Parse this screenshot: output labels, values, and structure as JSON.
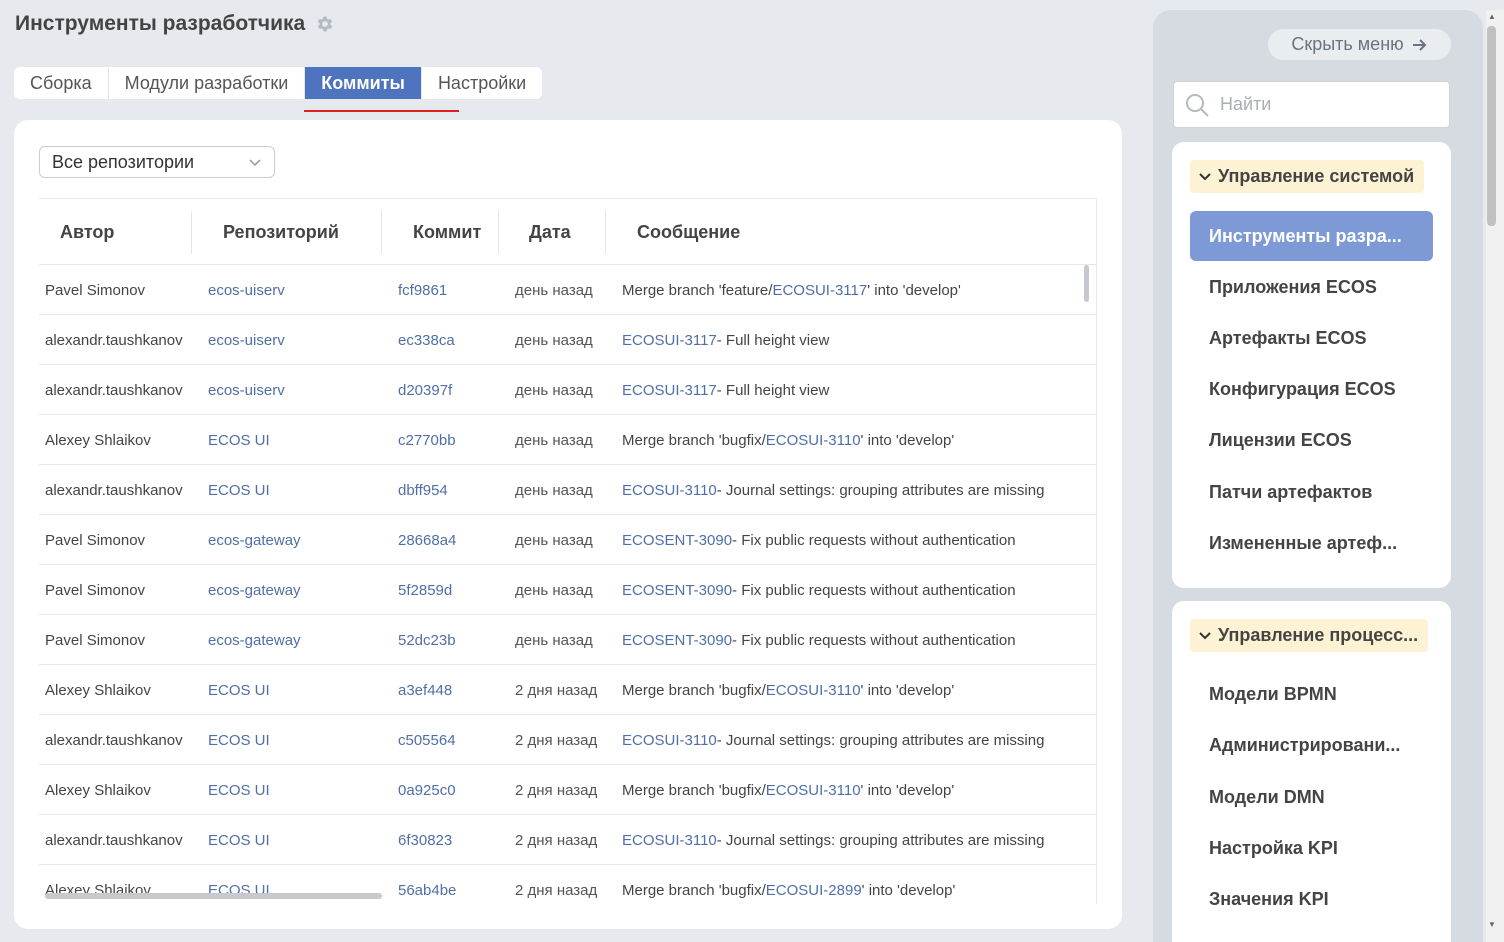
{
  "header": {
    "title": "Инструменты разработчика"
  },
  "tabs": [
    {
      "label": "Сборка"
    },
    {
      "label": "Модули разработки"
    },
    {
      "label": "Коммиты"
    },
    {
      "label": "Настройки"
    }
  ],
  "filter": {
    "selected": "Все репозитории"
  },
  "table": {
    "columns": [
      "Автор",
      "Репозиторий",
      "Коммит",
      "Дата",
      "Сообщение"
    ],
    "rows": [
      {
        "author": "Pavel Simonov",
        "repo": "ecos-uiserv",
        "commit": "fcf9861",
        "date": "день назад",
        "msg_pre": "Merge branch 'feature/",
        "msg_link": "ECOSUI-3117",
        "msg_post": "' into 'develop'"
      },
      {
        "author": "alexandr.taushkanov",
        "repo": "ecos-uiserv",
        "commit": "ec338ca",
        "date": "день назад",
        "msg_pre": "",
        "msg_link": "ECOSUI-3117",
        "msg_post": " - Full height view"
      },
      {
        "author": "alexandr.taushkanov",
        "repo": "ecos-uiserv",
        "commit": "d20397f",
        "date": "день назад",
        "msg_pre": "",
        "msg_link": "ECOSUI-3117",
        "msg_post": " - Full height view"
      },
      {
        "author": "Alexey Shlaikov",
        "repo": "ECOS UI",
        "commit": "c2770bb",
        "date": "день назад",
        "msg_pre": "Merge branch 'bugfix/",
        "msg_link": "ECOSUI-3110",
        "msg_post": "' into 'develop'"
      },
      {
        "author": "alexandr.taushkanov",
        "repo": "ECOS UI",
        "commit": "dbff954",
        "date": "день назад",
        "msg_pre": "",
        "msg_link": "ECOSUI-3110",
        "msg_post": " - Journal settings: grouping attributes are missing"
      },
      {
        "author": "Pavel Simonov",
        "repo": "ecos-gateway",
        "commit": "28668a4",
        "date": "день назад",
        "msg_pre": "",
        "msg_link": "ECOSENT-3090",
        "msg_post": " - Fix public requests without authentication"
      },
      {
        "author": "Pavel Simonov",
        "repo": "ecos-gateway",
        "commit": "5f2859d",
        "date": "день назад",
        "msg_pre": "",
        "msg_link": "ECOSENT-3090",
        "msg_post": " - Fix public requests without authentication"
      },
      {
        "author": "Pavel Simonov",
        "repo": "ecos-gateway",
        "commit": "52dc23b",
        "date": "день назад",
        "msg_pre": "",
        "msg_link": "ECOSENT-3090",
        "msg_post": " - Fix public requests without authentication"
      },
      {
        "author": "Alexey Shlaikov",
        "repo": "ECOS UI",
        "commit": "a3ef448",
        "date": "2 дня назад",
        "msg_pre": "Merge branch 'bugfix/",
        "msg_link": "ECOSUI-3110",
        "msg_post": "' into 'develop'"
      },
      {
        "author": "alexandr.taushkanov",
        "repo": "ECOS UI",
        "commit": "c505564",
        "date": "2 дня назад",
        "msg_pre": "",
        "msg_link": "ECOSUI-3110",
        "msg_post": " - Journal settings: grouping attributes are missing"
      },
      {
        "author": "Alexey Shlaikov",
        "repo": "ECOS UI",
        "commit": "0a925c0",
        "date": "2 дня назад",
        "msg_pre": "Merge branch 'bugfix/",
        "msg_link": "ECOSUI-3110",
        "msg_post": "' into 'develop'"
      },
      {
        "author": "alexandr.taushkanov",
        "repo": "ECOS UI",
        "commit": "6f30823",
        "date": "2 дня назад",
        "msg_pre": "",
        "msg_link": "ECOSUI-3110",
        "msg_post": " - Journal settings: grouping attributes are missing"
      },
      {
        "author": "Alexey Shlaikov",
        "repo": "ECOS UI",
        "commit": "56ab4be",
        "date": "2 дня назад",
        "msg_pre": "Merge branch 'bugfix/",
        "msg_link": "ECOSUI-2899",
        "msg_post": "' into 'develop'"
      }
    ]
  },
  "sidebar": {
    "hide_label": "Скрыть меню",
    "search_placeholder": "Найти",
    "groups": [
      {
        "title": "Управление системой",
        "items": [
          "Инструменты разра...",
          "Приложения ECOS",
          "Артефакты ECOS",
          "Конфигурация ECOS",
          "Лицензии ECOS",
          "Патчи артефактов",
          "Измененные артеф..."
        ]
      },
      {
        "title": "Управление процесс...",
        "items": [
          "Модели BPMN",
          "Администрировани...",
          "Модели DMN",
          "Настройка KPI",
          "Значения KPI"
        ]
      }
    ]
  },
  "colors": {
    "accent": "#4f74bf",
    "link": "#4f6fa8",
    "active_menu": "#7d9ad6",
    "group_header": "#fdf2d4",
    "tab_underline": "#e02020"
  }
}
